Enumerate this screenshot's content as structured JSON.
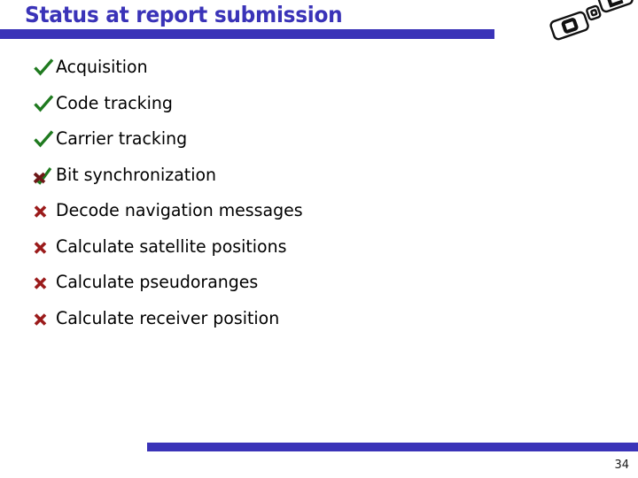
{
  "slide": {
    "title": "Status at report submission",
    "page_number": "34",
    "accent_color": "#3A33B8",
    "check_color": "#1F7A1F",
    "cross_color": "#9B1B1B",
    "text_color": "#000000",
    "background_color": "#FFFFFF"
  },
  "logo": {
    "name": "dgc-logo",
    "letters": [
      "D",
      "G",
      "C"
    ]
  },
  "bullets": [
    {
      "label": "Acquisition",
      "marker": "check",
      "marker_name": "check-icon"
    },
    {
      "label": "Code tracking",
      "marker": "check",
      "marker_name": "check-icon"
    },
    {
      "label": "Carrier tracking",
      "marker": "check",
      "marker_name": "check-icon"
    },
    {
      "label": "Bit synchronization",
      "marker": "check-cross",
      "marker_name": "check-cross-icon"
    },
    {
      "label": "Decode navigation messages",
      "marker": "cross",
      "marker_name": "cross-icon"
    },
    {
      "label": "Calculate satellite positions",
      "marker": "cross",
      "marker_name": "cross-icon"
    },
    {
      "label": "Calculate pseudoranges",
      "marker": "cross",
      "marker_name": "cross-icon"
    },
    {
      "label": "Calculate receiver position",
      "marker": "cross",
      "marker_name": "cross-icon"
    }
  ]
}
